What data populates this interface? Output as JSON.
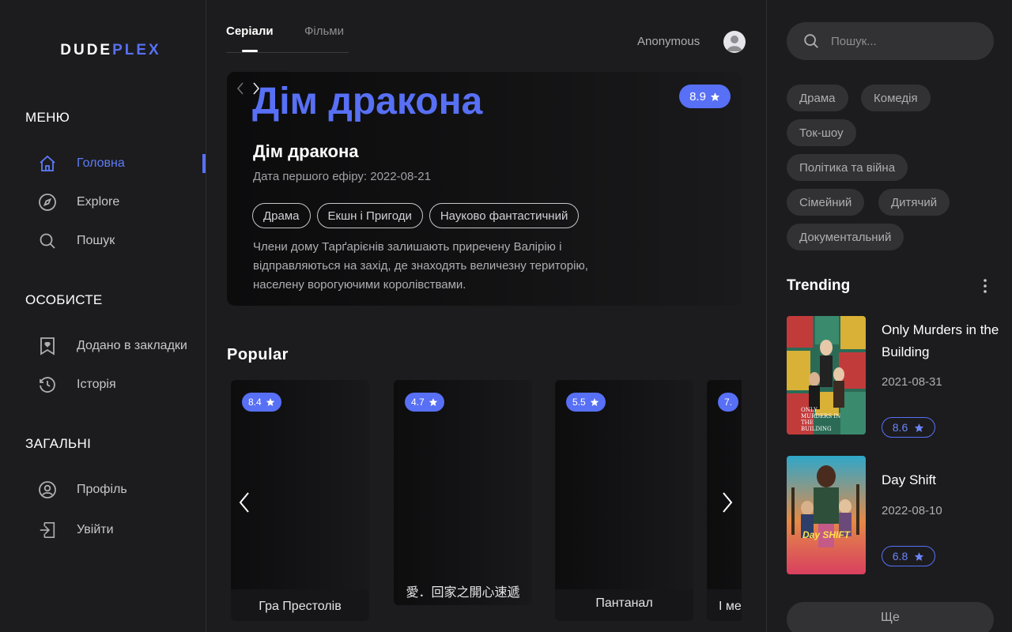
{
  "brand": {
    "part1": "DUDE",
    "part2": "PLEX"
  },
  "sidebar": {
    "menu_title": "МЕНЮ",
    "menu_items": [
      {
        "label": "Головна",
        "icon": "home-icon",
        "active": true
      },
      {
        "label": "Explore",
        "icon": "compass-icon"
      },
      {
        "label": "Пошук",
        "icon": "search-icon"
      }
    ],
    "personal_title": "ОСОБИСТЕ",
    "personal_items": [
      {
        "label": "Додано в закладки",
        "icon": "bookmark-icon"
      },
      {
        "label": "Історія",
        "icon": "history-icon"
      }
    ],
    "general_title": "ЗАГАЛЬНІ",
    "general_items": [
      {
        "label": "Профіль",
        "icon": "profile-icon"
      },
      {
        "label": "Увійти",
        "icon": "login-icon"
      }
    ]
  },
  "header": {
    "tabs": [
      {
        "label": "Серіали",
        "active": true
      },
      {
        "label": "Фільми"
      }
    ],
    "user_name": "Anonymous"
  },
  "hero": {
    "big_title": "Дім дракона",
    "title": "Дім дракона",
    "date": "Дата першого ефіру: 2022-08-21",
    "rating": "8.9",
    "genres": [
      "Драма",
      "Екшн і Пригоди",
      "Науково фантастичний"
    ],
    "description": "Члени дому Тарґарієнів залишають приречену Валірію і відправляються на захід, де знаходять величезну територію, населену ворогуючими королівствами."
  },
  "popular": {
    "title": "Popular",
    "cards": [
      {
        "rating": "8.4",
        "title": "Гра Престолів"
      },
      {
        "rating": "4.7",
        "title": "愛．回家之開心速遞"
      },
      {
        "rating": "5.5",
        "title": "Пантанал"
      },
      {
        "rating": "7.",
        "title": "І ме"
      }
    ]
  },
  "search": {
    "placeholder": "Пошук..."
  },
  "genre_chips": [
    "Драма",
    "Комедія",
    "Ток-шоу",
    "Політика та війна",
    "Сімейний",
    "Дитячий",
    "Документальний"
  ],
  "trending": {
    "title": "Trending",
    "items": [
      {
        "name": "Only Murders in the Building",
        "date": "2021-08-31",
        "rating": "8.6",
        "poster_text": "ONLY MURDERS IN THE BUILDING"
      },
      {
        "name": "Day Shift",
        "date": "2022-08-10",
        "rating": "6.8",
        "poster_text": "Day SHIFT"
      }
    ],
    "more_label": "Ще"
  },
  "colors": {
    "accent": "#5870f5",
    "bg": "#1c1c1e",
    "chip": "#323235"
  }
}
